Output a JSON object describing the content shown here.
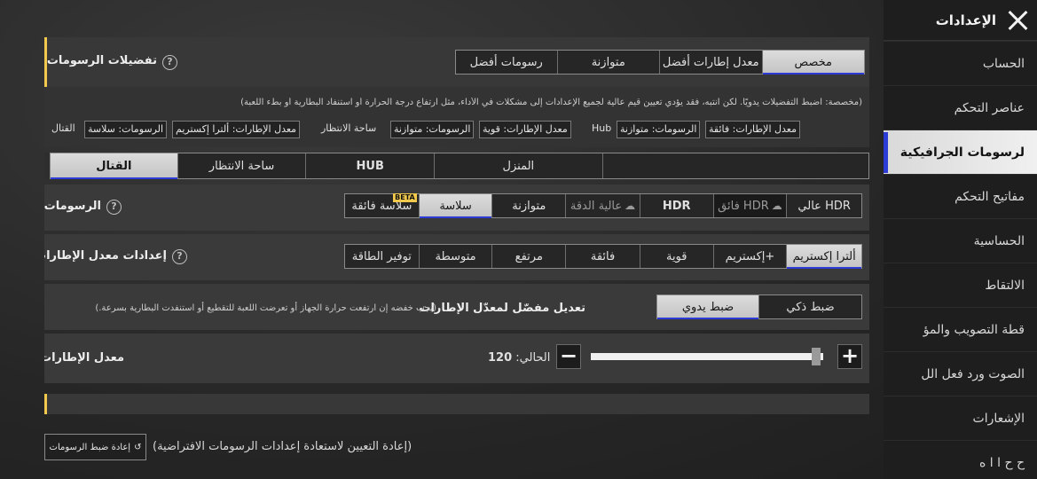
{
  "header": {
    "title": "الإعدادات"
  },
  "sidebar": {
    "items": [
      {
        "label": "الحساب"
      },
      {
        "label": "عناصر التحكم"
      },
      {
        "label": "لرسومات الجرافيكية"
      },
      {
        "label": "مفاتيح التحكم"
      },
      {
        "label": "الحساسية"
      },
      {
        "label": "الالتقاط"
      },
      {
        "label": "قطة التصويب والمؤ"
      },
      {
        "label": "الصوت ورد فعل الل"
      },
      {
        "label": "الإشعارات"
      },
      {
        "label": "ح ح   ا  ا  ه"
      }
    ]
  },
  "prefs": {
    "title": "تفضيلات الرسومات",
    "options": [
      "مخصص",
      "معدل إطارات أفضل",
      "متوازنة",
      "رسومات أفضل"
    ],
    "description": "(مخصصة: اضبط التفضيلات يدويًا. لكن انتبه، فقد يؤدي تعيين قيم عالية لجميع الإعدادات إلى مشكلات في الأداء، مثل ارتفاع درجة الحرارة أو استنفاد البطارية أو بطء اللعبة)",
    "modes": {
      "hub_label": "Hub",
      "lobby_label": "ساحة الانتظار",
      "combat_label": "القتال",
      "chips": {
        "hub_fps": "معدل الإطارات: فائقة",
        "hub_gfx": "الرسومات: متوازنة",
        "lobby_fps": "معدل الإطارات: قوية",
        "lobby_gfx": "الرسومات: متوازنة",
        "combat_fps": "معدل الإطارات: ألترا إكستريم",
        "combat_gfx": "الرسومات: سلاسة"
      }
    }
  },
  "tabs": [
    "المنزل",
    "HUB",
    "ساحة الانتظار",
    "القتال"
  ],
  "graphics": {
    "label": "الرسومات",
    "options": [
      "عالي HDR",
      "فائق HDR",
      "HDR",
      "عالية الدقة",
      "متوازنة",
      "سلاسة",
      "سلاسة فائقة"
    ],
    "beta": "BETA"
  },
  "fps_settings": {
    "label": "إعدادات معدل الإطارات",
    "options": [
      "ألترا إكستريم",
      "إكستريم+",
      "قوية",
      "فائقة",
      "مرتفع",
      "متوسطة",
      "توفير الطاقة"
    ]
  },
  "adaptive": {
    "label": "تعديل مفصّل لمعدّل الإطارات",
    "note": "(يجب خفضه إن ارتفعت حرارة الجهاز أو تعرضت اللعبة للتقطيع أو استنفدت البطارية بسرعة.)",
    "options": [
      "ضبط ذكي",
      "ضبط يدوي"
    ]
  },
  "fps": {
    "label": "معدل الإطارات",
    "current_label": "الحالي:",
    "current_value": "120",
    "level": 0.97,
    "minus": "−",
    "plus": "+"
  },
  "footer": {
    "reset_button": "إعادة ضبط الرسومات",
    "reset_text": "(إعادة التعيين لاستعادة إعدادات الرسومات الافتراضية)"
  },
  "colors": {
    "accent": "#2c3bd6",
    "highlight": "#f2c94c",
    "selected_bg": "#d0d0d0"
  }
}
